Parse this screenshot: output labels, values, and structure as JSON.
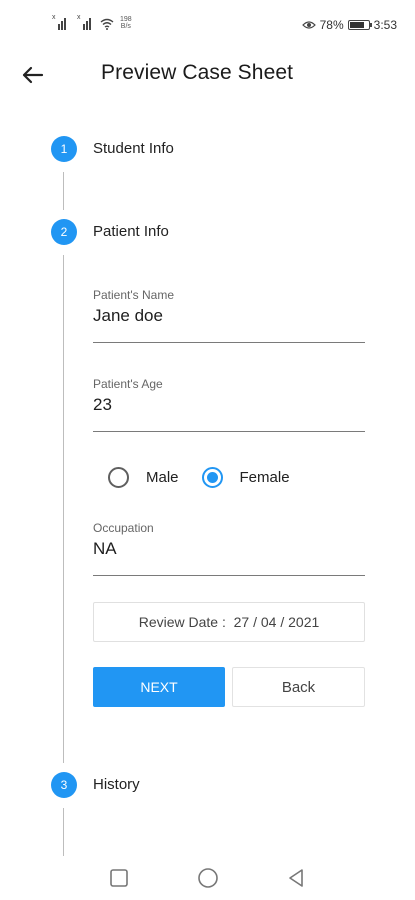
{
  "status_bar": {
    "net_speed_value": "198",
    "net_speed_unit": "B/s",
    "battery_percent": "78%",
    "battery_level": 0.78,
    "time": "3:53"
  },
  "header": {
    "back_icon": "arrow-left-icon",
    "title": "Preview Case Sheet"
  },
  "steps": [
    {
      "number": "1",
      "label": "Student Info"
    },
    {
      "number": "2",
      "label": "Patient Info"
    },
    {
      "number": "3",
      "label": "History"
    }
  ],
  "form": {
    "name": {
      "label": "Patient's Name",
      "value": "Jane doe"
    },
    "age": {
      "label": "Patient's Age",
      "value": "23"
    },
    "gender": {
      "options": [
        {
          "label": "Male",
          "checked": false
        },
        {
          "label": "Female",
          "checked": true
        }
      ]
    },
    "occupation": {
      "label": "Occupation",
      "value": "NA"
    },
    "review_date": "Review Date :  27 / 04 / 2021"
  },
  "actions": {
    "next_label": "NEXT",
    "back_label": "Back"
  },
  "colors": {
    "accent": "#2196f3",
    "connector": "#bdbdbd"
  },
  "nav": {
    "icons": [
      "square-icon",
      "circle-home-icon",
      "triangle-back-icon"
    ]
  }
}
